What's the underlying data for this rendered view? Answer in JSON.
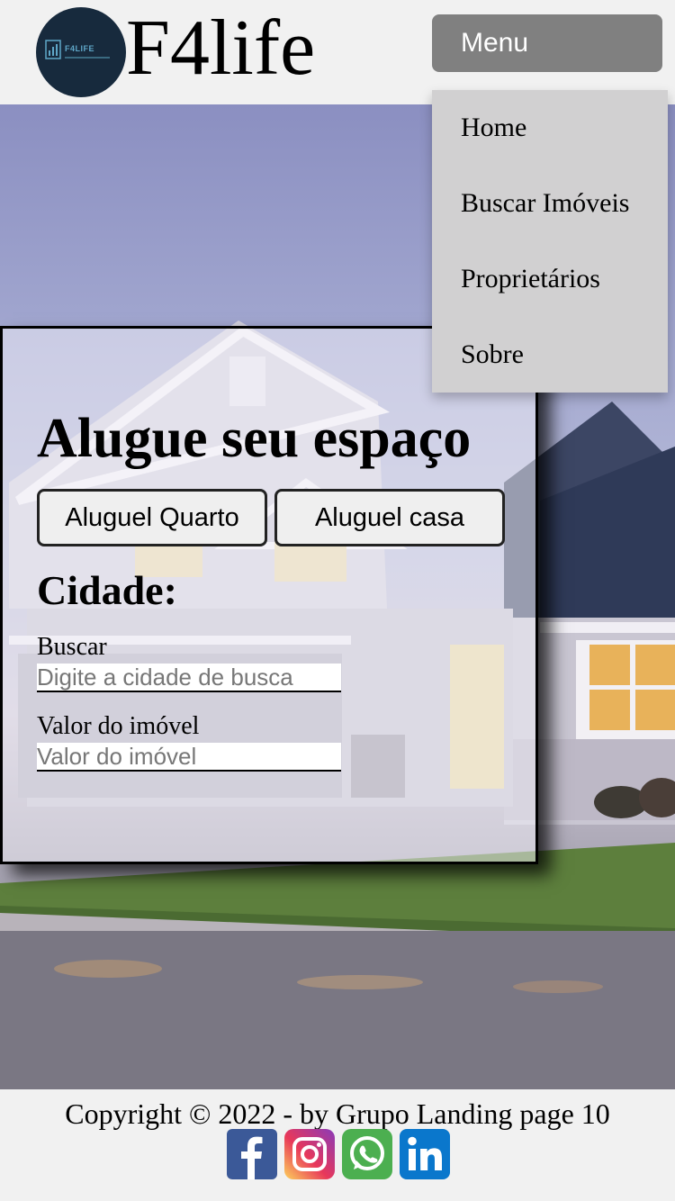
{
  "header": {
    "logo_brand": "F4LIFE",
    "site_title": "F4life",
    "menu_label": "Menu"
  },
  "menu": {
    "items": [
      {
        "label": "Home"
      },
      {
        "label": "Buscar Imóveis"
      },
      {
        "label": "Proprietários"
      },
      {
        "label": "Sobre"
      }
    ]
  },
  "search": {
    "title": "Alugue seu espaço",
    "options": [
      "Aluguel Quarto",
      "Aluguel casa"
    ],
    "city_heading": "Cidade:",
    "fields": [
      {
        "label": "Buscar",
        "placeholder": "Digite a cidade de busca"
      },
      {
        "label": "Valor do imóvel",
        "placeholder": "Valor do imóvel"
      }
    ]
  },
  "footer": {
    "copyright": "Copyright © 2022 - by Grupo Landing page 10",
    "social": [
      {
        "icon": "facebook-icon",
        "color": "#3b5998"
      },
      {
        "icon": "instagram-icon",
        "color": "#d6249f"
      },
      {
        "icon": "whatsapp-icon",
        "color": "#4caf50"
      },
      {
        "icon": "linkedin-icon",
        "color": "#0a77cc"
      }
    ]
  }
}
